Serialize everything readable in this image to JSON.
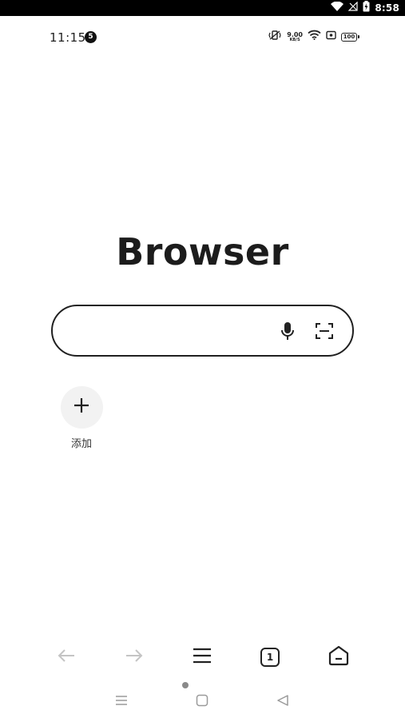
{
  "system_bar": {
    "time": "8:58",
    "icons": [
      "wifi-icon",
      "no-signal-icon",
      "battery-charging-icon"
    ],
    "background": "#000000"
  },
  "phone_status": {
    "time": "11:15",
    "notification_count": "5",
    "network_speed_value": "9.00",
    "network_speed_unit": "KB/S",
    "battery_level": "100",
    "icons": [
      "vibrate-icon",
      "wifi-icon",
      "screen-record-icon",
      "battery-icon"
    ]
  },
  "logo": {
    "text": "Browser"
  },
  "search": {
    "placeholder": "",
    "value": "",
    "icons": [
      "microphone-icon",
      "scan-icon"
    ]
  },
  "shortcuts": [
    {
      "label": "添加",
      "icon": "plus-icon"
    }
  ],
  "toolbar": {
    "tab_count": "1",
    "icons": [
      "back-arrow-icon",
      "forward-arrow-icon",
      "menu-icon",
      "tabs-icon",
      "home-icon"
    ],
    "disabled_color": "#c4c4c4",
    "active_color": "#222222"
  },
  "navigation_bar": {
    "icons": [
      "recents-icon",
      "home-square-icon",
      "back-triangle-icon"
    ],
    "color": "#9a9a9a"
  }
}
